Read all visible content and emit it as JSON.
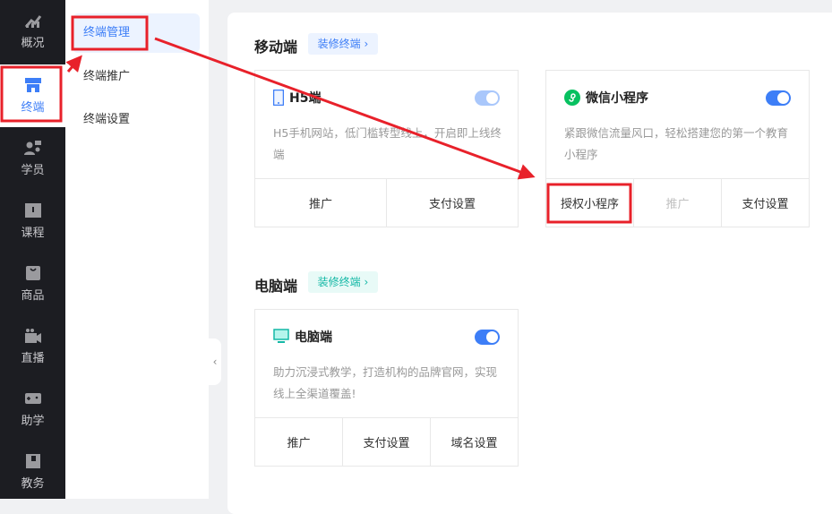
{
  "sidebar": {
    "items": [
      {
        "label": "概况",
        "icon": "chart-icon"
      },
      {
        "label": "终端",
        "icon": "store-icon",
        "active": true
      },
      {
        "label": "学员",
        "icon": "users-icon"
      },
      {
        "label": "课程",
        "icon": "book-icon"
      },
      {
        "label": "商品",
        "icon": "bag-icon"
      },
      {
        "label": "直播",
        "icon": "video-icon"
      },
      {
        "label": "助学",
        "icon": "gamepad-icon"
      },
      {
        "label": "教务",
        "icon": "notebook-icon"
      }
    ]
  },
  "submenu": {
    "items": [
      {
        "label": "终端管理",
        "active": true
      },
      {
        "label": "终端推广"
      },
      {
        "label": "终端设置"
      }
    ]
  },
  "mobile": {
    "title": "移动端",
    "decorate": "装修终端",
    "h5": {
      "name": "H5端",
      "desc": "H5手机网站，低门槛转型线上，开启即上线终端",
      "enabled": true,
      "actions": [
        "推广",
        "支付设置"
      ]
    },
    "wechat": {
      "name": "微信小程序",
      "desc": "紧跟微信流量风口，轻松搭建您的第一个教育小程序",
      "enabled": true,
      "actions": [
        "授权小程序",
        "推广",
        "支付设置"
      ]
    }
  },
  "pc": {
    "title": "电脑端",
    "decorate": "装修终端",
    "card": {
      "name": "电脑端",
      "desc": "助力沉浸式教学，打造机构的品牌官网，实现线上全渠道覆盖!",
      "enabled": true,
      "actions": [
        "推广",
        "支付设置",
        "域名设置"
      ]
    }
  },
  "colors": {
    "accent": "#3d7ef7",
    "teal": "#14b8a6",
    "annotation": "#e8212a"
  }
}
